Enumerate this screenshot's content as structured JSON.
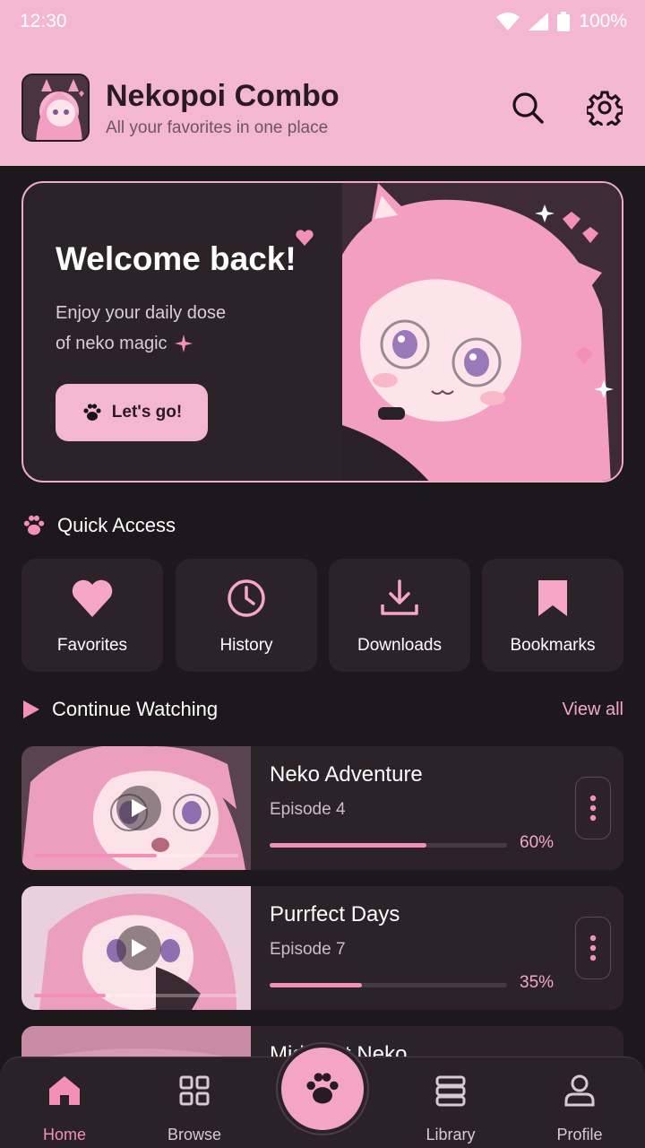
{
  "status": {
    "time": "12:30",
    "battery": "100%"
  },
  "header": {
    "title": "Nekopoi Combo",
    "subtitle": "All your favorites in one place",
    "search_icon": "search-icon",
    "settings_icon": "gear-icon"
  },
  "hero": {
    "title": "Welcome back!",
    "subtitle_line1": "Enjoy your daily dose",
    "subtitle_line2": "of neko magic",
    "button_label": "Let's go!"
  },
  "quick_access": {
    "title": "Quick Access",
    "items": [
      {
        "label": "Favorites",
        "icon": "heart-icon"
      },
      {
        "label": "History",
        "icon": "clock-icon"
      },
      {
        "label": "Downloads",
        "icon": "download-icon"
      },
      {
        "label": "Bookmarks",
        "icon": "bookmark-icon"
      }
    ]
  },
  "continue_watching": {
    "title": "Continue Watching",
    "view_all": "View all",
    "items": [
      {
        "title": "Neko Adventure",
        "episode": "Episode 4",
        "progress_label": "60%",
        "progress": 0.6
      },
      {
        "title": "Purrfect Days",
        "episode": "Episode 7",
        "progress_label": "35%",
        "progress": 0.35
      },
      {
        "title": "Midnight Neko",
        "episode": "",
        "progress_label": "",
        "progress": 0
      }
    ]
  },
  "bottom_nav": {
    "items": [
      {
        "label": "Home",
        "icon": "home-icon",
        "active": true
      },
      {
        "label": "Browse",
        "icon": "grid-icon",
        "active": false
      },
      {
        "label": "Library",
        "icon": "stack-icon",
        "active": false
      },
      {
        "label": "Profile",
        "icon": "user-icon",
        "active": false
      }
    ],
    "fab_icon": "paw-icon"
  },
  "colors": {
    "accent_pink": "#f4b7d1",
    "progress_pink": "#f48fb8",
    "background": "#1d181c",
    "card": "#2b2328"
  }
}
